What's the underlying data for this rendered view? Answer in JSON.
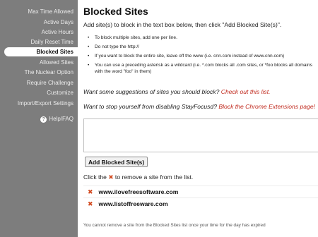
{
  "sidebar": {
    "items": [
      {
        "label": "Max Time Allowed",
        "active": false
      },
      {
        "label": "Active Days",
        "active": false
      },
      {
        "label": "Active Hours",
        "active": false
      },
      {
        "label": "Daily Reset Time",
        "active": false
      },
      {
        "label": "Blocked Sites",
        "active": true
      },
      {
        "label": "Allowed Sites",
        "active": false
      },
      {
        "label": "The Nuclear Option",
        "active": false
      },
      {
        "label": "Require Challenge",
        "active": false
      },
      {
        "label": "Customize",
        "active": false
      },
      {
        "label": "Import/Export Settings",
        "active": false
      }
    ],
    "help": {
      "icon": "question-icon",
      "glyph": "?",
      "label": "Help/FAQ"
    }
  },
  "main": {
    "title": "Blocked Sites",
    "intro": "Add site(s) to block in the text box below, then click \"Add Blocked Site(s)\".",
    "bullets": [
      "To block multiple sites, add one per line.",
      "Do not type the http://",
      "If you want to block the entire site, leave off the www (i.e. cnn.com instead of www.cnn.com)",
      "You can use a preceding asterisk as a wildcard (i.e. *.com blocks all .com sites, or *foo blocks all domains with the word \"foo\" in them)"
    ],
    "suggest_text": "Want some suggestions of sites you should block? ",
    "suggest_link": "Check out this list.",
    "stop_text": "Want to stop yourself from disabling StayFocusd? ",
    "stop_link": "Block the Chrome Extensions page!",
    "textarea_value": "",
    "add_button": "Add Blocked Site(s)",
    "remove_hint_before": "Click the ",
    "remove_hint_after": " to remove a site from the list.",
    "remove_glyph": "✖",
    "blocked_sites": [
      "www.ilovefreesoftware.com",
      "www.listoffreeware.com"
    ],
    "footnote": "You cannot remove a site from the Blocked Sites list once your time for the day has expired"
  },
  "colors": {
    "sidebar_bg": "#7d7d7d",
    "link": "#c0291d",
    "remove": "#d2491f"
  }
}
